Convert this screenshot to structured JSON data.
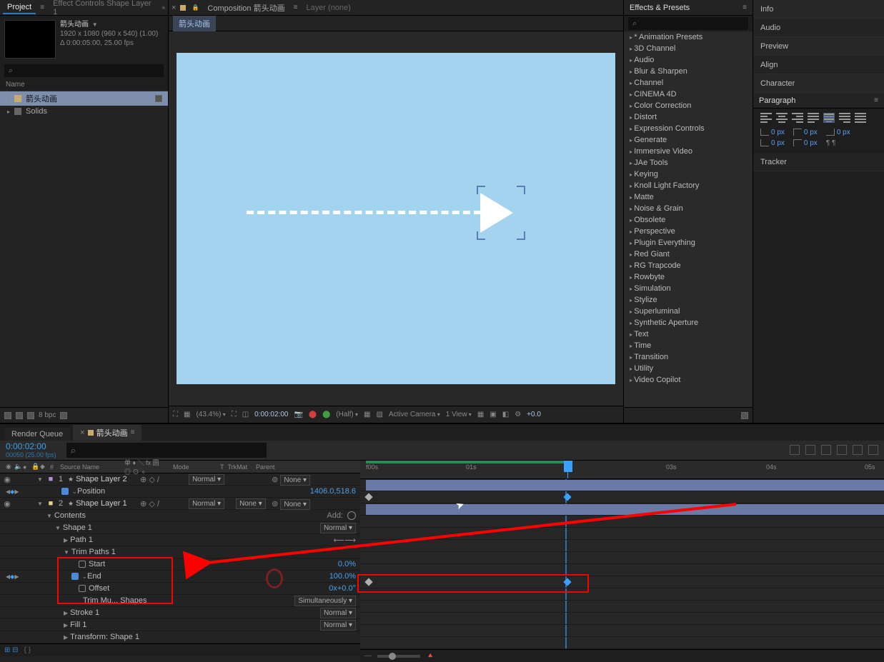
{
  "project": {
    "tabs": {
      "project": "Project",
      "effectControls": "Effect Controls Shape Layer 1"
    },
    "comp": {
      "name": "箭头动画",
      "dims": "1920 x 1080 (960 x 540) (1.00)",
      "dur": "Δ 0:00:05:00, 25.00 fps"
    },
    "listHeader": "Name",
    "items": [
      {
        "name": "箭头动画",
        "type": "comp"
      },
      {
        "name": "Solids",
        "type": "folder"
      }
    ],
    "footer": {
      "bpc": "8 bpc"
    },
    "search": "⌕"
  },
  "comp_panel": {
    "tabs": {
      "composition": "Composition",
      "compName": "箭头动画",
      "layer": "Layer (none)"
    },
    "subtab": "箭头动画",
    "footer": {
      "zoom": "(43.4%)",
      "time": "0:00:02:00",
      "res": "(Half)",
      "camera": "Active Camera",
      "view": "1 View",
      "exp": "+0.0"
    }
  },
  "effects": {
    "title": "Effects & Presets",
    "search": "⌕",
    "items": [
      "* Animation Presets",
      "3D Channel",
      "Audio",
      "Blur & Sharpen",
      "Channel",
      "CINEMA 4D",
      "Color Correction",
      "Distort",
      "Expression Controls",
      "Generate",
      "Immersive Video",
      "JAe Tools",
      "Keying",
      "Knoll Light Factory",
      "Matte",
      "Noise & Grain",
      "Obsolete",
      "Perspective",
      "Plugin Everything",
      "Red Giant",
      "RG Trapcode",
      "Rowbyte",
      "Simulation",
      "Stylize",
      "Superluminal",
      "Synthetic Aperture",
      "Text",
      "Time",
      "Transition",
      "Utility",
      "Video Copilot"
    ]
  },
  "side": {
    "info": "Info",
    "audio": "Audio",
    "preview": "Preview",
    "align": "Align",
    "character": "Character",
    "paragraph": "Paragraph",
    "tracker": "Tracker"
  },
  "paragraph": {
    "px": "0 px"
  },
  "timeline": {
    "tabs": {
      "renderQueue": "Render Queue",
      "comp": "箭头动画"
    },
    "timecode": "0:00:02:00",
    "timecode_sub": "00050 (25.00 fps)",
    "search": "⌕",
    "ruler": [
      "f00s",
      "01s",
      "",
      "03s",
      "04s",
      "05s"
    ],
    "headers": {
      "sourceName": "Source Name",
      "switches": "单 ♦ ╲ fx 圆 ◎ ⊙ ⚬",
      "mode": "Mode",
      "t": "T",
      "trkmat": "TrkMat",
      "parent": "Parent"
    },
    "layers": [
      {
        "idx": "1",
        "name": "Shape Layer 2",
        "mode": "Normal",
        "trkmat": "",
        "parent": "None",
        "color": "c1"
      },
      {
        "idx": "2",
        "name": "Shape Layer 1",
        "mode": "Normal",
        "trkmat": "None",
        "parent": "None",
        "color": "c2"
      }
    ],
    "props": {
      "position": {
        "name": "Position",
        "value": "1406.0,518.6"
      },
      "contents": "Contents",
      "add": "Add:",
      "shape1": "Shape 1",
      "shape1_mode": "Normal",
      "path1": "Path 1",
      "trim": {
        "title": "Trim Paths 1",
        "start": {
          "name": "Start",
          "value": "0.0%"
        },
        "end": {
          "name": "End",
          "value": "100.0%"
        },
        "offset": {
          "name": "Offset",
          "value": "0x+0.0°"
        },
        "shapes": {
          "name": "Trim Mu... Shapes",
          "value": "Simultaneously"
        }
      },
      "stroke": {
        "name": "Stroke 1",
        "value": "Normal"
      },
      "fill": {
        "name": "Fill 1",
        "value": "Normal"
      },
      "transform": "Transform: Shape 1"
    }
  }
}
